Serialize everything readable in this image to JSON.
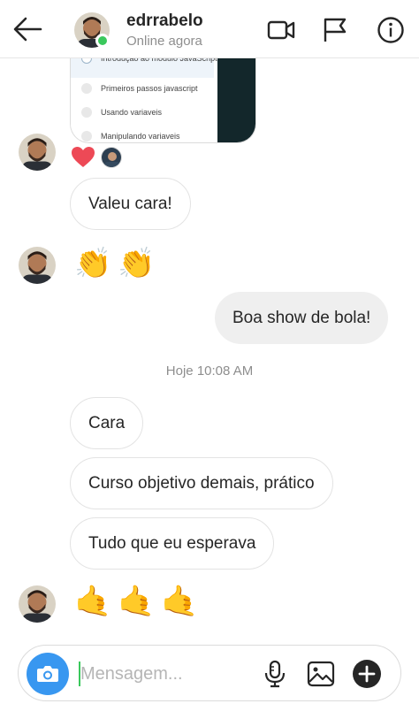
{
  "header": {
    "username": "edrrabelo",
    "status": "Online agora",
    "icons": [
      "back-arrow-icon",
      "video-call-icon",
      "flag-icon",
      "info-icon"
    ]
  },
  "shared_card": {
    "items": [
      "Introdução ao módulo JavaScript",
      "Primeiros passos javascript",
      "Usando variaveis",
      "Manipulando variaveis"
    ]
  },
  "reactions": {
    "icon": "heart-icon",
    "color": "#ed4956"
  },
  "messages": {
    "m1": "Valeu cara!",
    "emoji_clap": "👏",
    "m2": "Boa show de bola!",
    "timestamp": "Hoje 10:08 AM",
    "m3": "Cara",
    "m4": "Curso objetivo demais, prático",
    "m5": "Tudo que eu esperava",
    "emoji_hand": "🤙"
  },
  "composer": {
    "placeholder": "Mensagem...",
    "value": "",
    "icons": [
      "camera-icon",
      "microphone-icon",
      "gallery-icon",
      "add-icon"
    ]
  },
  "colors": {
    "accent": "#3897f0",
    "online": "#3ac85c",
    "outgoing_bubble": "#efefef"
  }
}
